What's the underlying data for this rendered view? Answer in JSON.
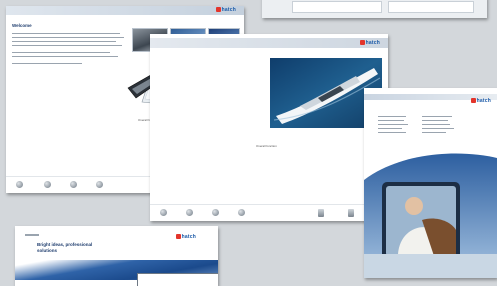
{
  "sheets": {
    "main": {
      "logo": "hatch",
      "heading": "Welcome",
      "caption": "Overall function"
    },
    "yacht": {
      "logo": "hatch",
      "caption": "Overall function"
    },
    "window": {
      "logo": "hatch"
    },
    "bottom": {
      "logo": "hatch",
      "heading_line1": "Bright ideas, professional",
      "heading_line2": "solutions"
    }
  },
  "colors": {
    "background": "#d3d7db",
    "brand_blue": "#1b5aa8",
    "brand_red": "#e3352b"
  }
}
